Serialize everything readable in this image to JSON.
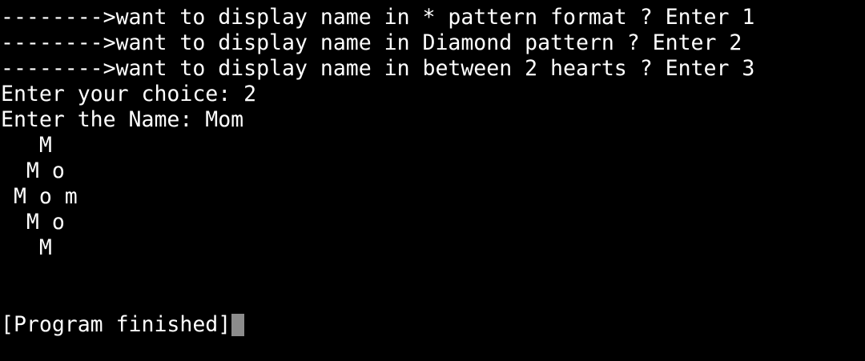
{
  "terminal": {
    "lines": [
      "-------->want to display name in * pattern format ? Enter 1",
      "-------->want to display name in Diamond pattern ? Enter 2",
      "-------->want to display name in between 2 hearts ? Enter 3",
      "Enter your choice: 2",
      "Enter the Name: Mom",
      "   M",
      "  M o",
      " M o m",
      "  M o",
      "   M",
      "",
      "",
      "[Program finished]"
    ],
    "colors": {
      "background": "#000000",
      "text": "#ffffff",
      "cursor": "#8c8c8c"
    }
  }
}
